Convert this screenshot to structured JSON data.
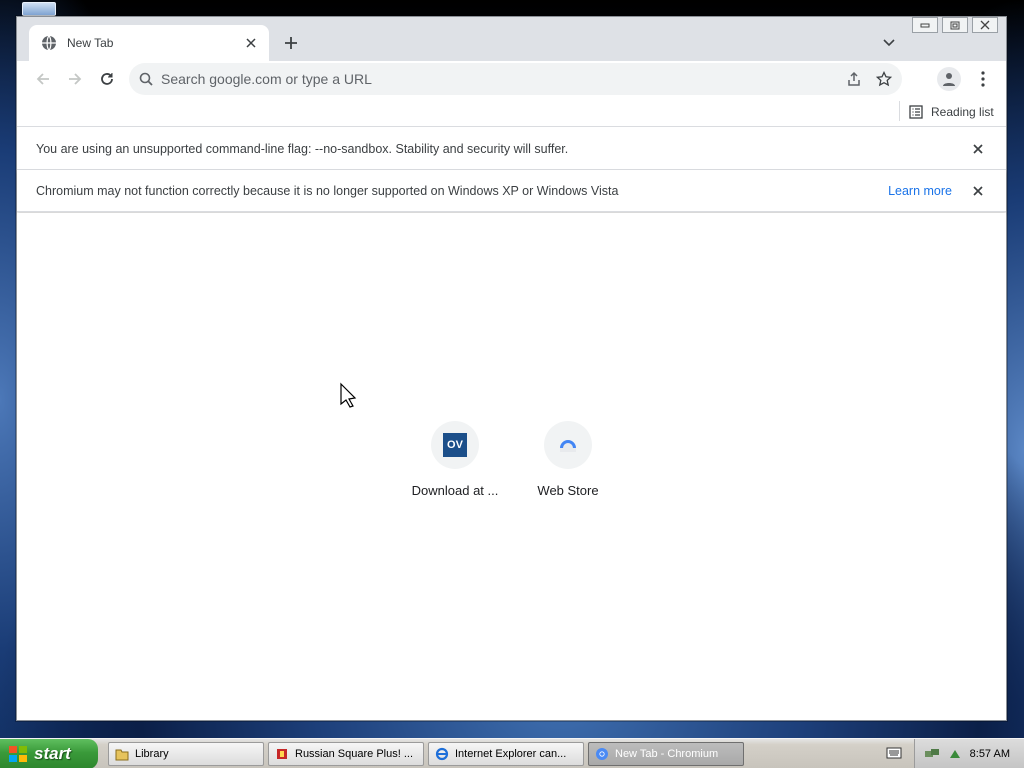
{
  "browser": {
    "tab": {
      "title": "New Tab"
    },
    "omnibox": {
      "placeholder": "Search google.com or type a URL"
    },
    "bookmarks_bar": {
      "reading_list_label": "Reading list"
    },
    "infobars": [
      {
        "message": "You are using an unsupported command-line flag: --no-sandbox. Stability and security will suffer."
      },
      {
        "message": "Chromium may not function correctly because it is no longer supported on Windows XP or Windows Vista",
        "link": "Learn more"
      }
    ],
    "shortcuts": [
      {
        "label": "Download at ...",
        "icon": "ov-logo-icon",
        "logo_text": "OV"
      },
      {
        "label": "Web Store",
        "icon": "web-store-icon"
      }
    ]
  },
  "taskbar": {
    "start_label": "start",
    "tasks": [
      {
        "label": "Library",
        "icon": "folder-icon"
      },
      {
        "label": "Russian Square Plus! ...",
        "icon": "game-icon"
      },
      {
        "label": "Internet Explorer can...",
        "icon": "ie-icon"
      },
      {
        "label": "New Tab - Chromium",
        "icon": "chromium-icon",
        "active": true
      }
    ],
    "clock": "8:57 AM"
  },
  "colors": {
    "accent": "#1a73e8",
    "tab_strip": "#dee1e6",
    "omnibox_bg": "#f1f3f4",
    "start_green": "#3a9a3a"
  }
}
